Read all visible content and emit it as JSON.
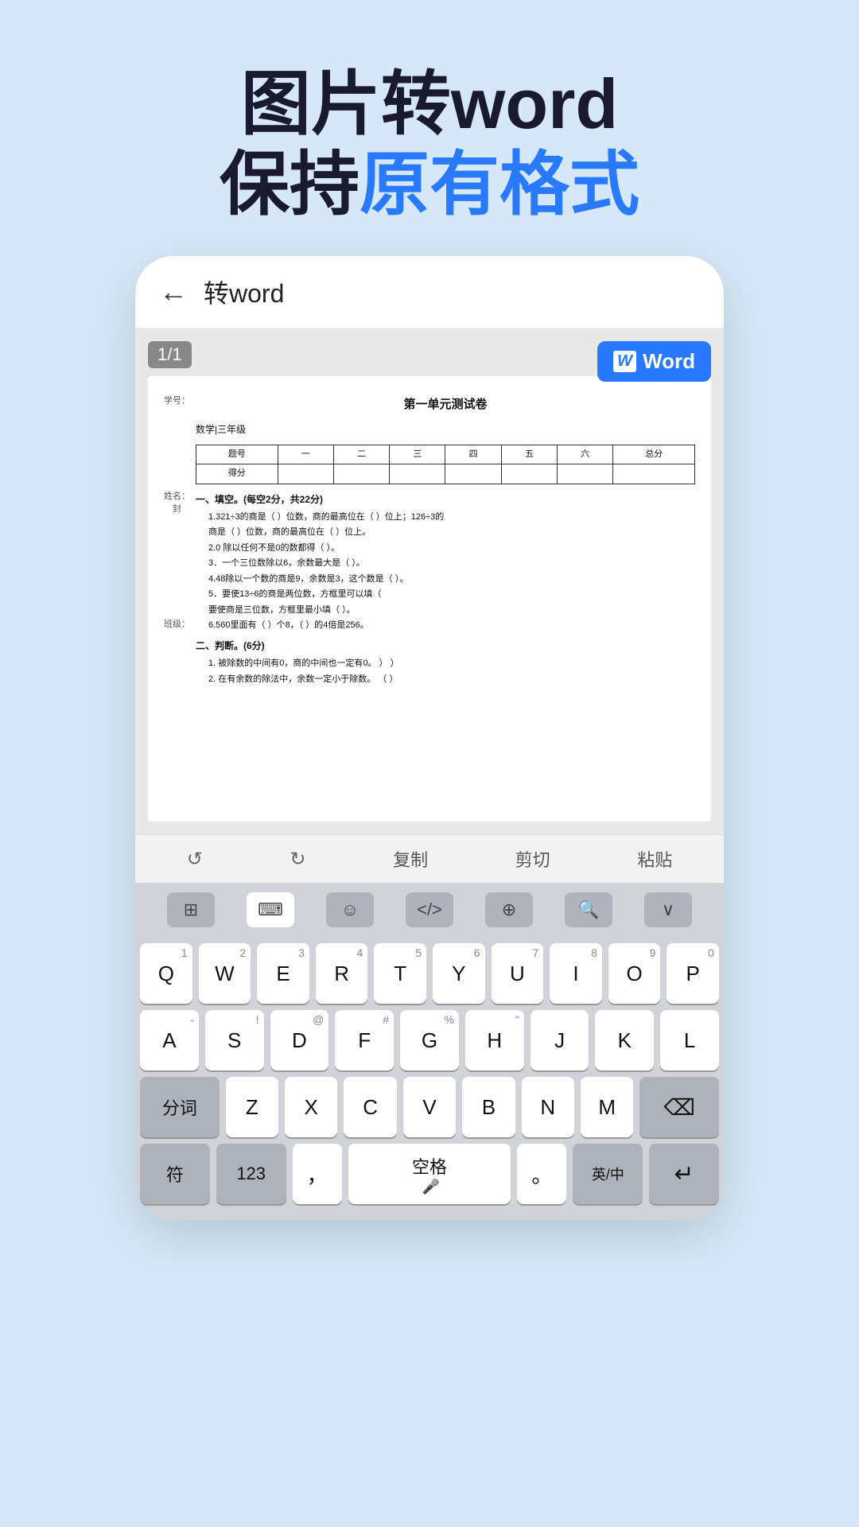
{
  "hero": {
    "line1": "图片转word",
    "line2_prefix": "保持",
    "line2_blue": "原有格式",
    "line2_suffix": ""
  },
  "appbar": {
    "back": "←",
    "title": "转word"
  },
  "page_indicator": "1/1",
  "word_button": "Word",
  "document": {
    "title": "第一单元测试卷",
    "xuehao": "学号：",
    "subject": "数学|三年级",
    "table_headers": [
      "题号",
      "一",
      "二",
      "三",
      "四",
      "五",
      "六",
      "总分"
    ],
    "table_row": [
      "得分",
      "",
      "",
      "",
      "",
      "",
      "",
      ""
    ],
    "sections": [
      {
        "title": "一、填空。(每空2分，共22分)",
        "questions": [
          "1.321÷3的商是（ ）位数，商的最高位在（ ）位上；126÷3的",
          "商是（ ）位数，商的最高位在（ ）位上。",
          "2.0 除以任何不是0的数都得（ ）。",
          "3．一个三位数除以6，余数最大是（ ）。",
          "4.48除以一个数的商是9，余数是3，这个数是（ ）。",
          "5．要使13÷6的商是两位数，方框里可以填（",
          "要使商是三位数，方框里最小填（ ）。",
          "6.560里面有（  ）个8，（ ）的4倍是256。"
        ]
      },
      {
        "title": "二、判断。(6分)",
        "questions": [
          "1. 被除数的中间有0，商的中间也一定有0。    ）            ）",
          "2. 在有余数的除法中，余数一定小于除数。  （ ）"
        ]
      }
    ],
    "side_labels": {
      "name": "姓名：",
      "seal": "封",
      "class": "班级："
    }
  },
  "toolbar": {
    "undo": "↺",
    "redo": "↻",
    "copy": "复制",
    "cut": "剪切",
    "paste": "粘贴"
  },
  "keyboard_switcher": {
    "buttons": [
      "⊞",
      "⌨",
      "☺",
      "</>",
      "⊕",
      "🔍",
      "∨"
    ]
  },
  "keyboard": {
    "row1": [
      {
        "main": "Q",
        "sub": "1"
      },
      {
        "main": "W",
        "sub": "2"
      },
      {
        "main": "E",
        "sub": "3"
      },
      {
        "main": "R",
        "sub": "4"
      },
      {
        "main": "T",
        "sub": "5"
      },
      {
        "main": "Y",
        "sub": "6"
      },
      {
        "main": "U",
        "sub": "7"
      },
      {
        "main": "I",
        "sub": "8"
      },
      {
        "main": "O",
        "sub": "9"
      },
      {
        "main": "P",
        "sub": "0"
      }
    ],
    "row2": [
      {
        "main": "A",
        "sub": "-"
      },
      {
        "main": "S",
        "sub": "!"
      },
      {
        "main": "D",
        "sub": "@"
      },
      {
        "main": "F",
        "sub": "#"
      },
      {
        "main": "G",
        "sub": "%"
      },
      {
        "main": "H",
        "sub": "\""
      },
      {
        "main": "J",
        "sub": ""
      },
      {
        "main": "K",
        "sub": ""
      },
      {
        "main": "L",
        "sub": ""
      }
    ],
    "row3_left": "分词",
    "row3": [
      {
        "main": "Z",
        "sub": ""
      },
      {
        "main": "X",
        "sub": ""
      },
      {
        "main": "C",
        "sub": ""
      },
      {
        "main": "V",
        "sub": ""
      },
      {
        "main": "B",
        "sub": ""
      },
      {
        "main": "N",
        "sub": ""
      },
      {
        "main": "M",
        "sub": ""
      }
    ],
    "row3_right": "⌫",
    "row4_sym": "符",
    "row4_num": "123",
    "row4_comma": "，",
    "row4_space": "空格",
    "row4_period": "。",
    "row4_lang": "英/中",
    "row4_enter": "↵"
  }
}
